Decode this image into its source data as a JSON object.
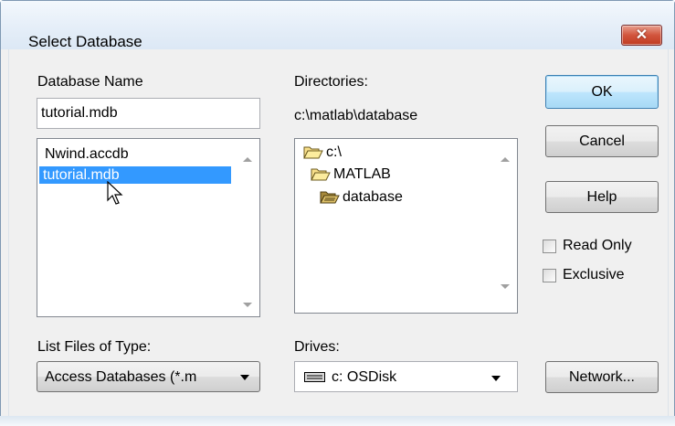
{
  "dialog": {
    "title": "Select Database",
    "close_glyph": "✕"
  },
  "database_name": {
    "label": "Database Name",
    "value": "tutorial.mdb",
    "files": [
      "Nwind.accdb",
      "tutorial.mdb"
    ],
    "selected_file": "tutorial.mdb"
  },
  "directories": {
    "label": "Directories:",
    "current_path": "c:\\matlab\\database",
    "tree": [
      {
        "name": "c:\\",
        "icon": "open-folder-icon"
      },
      {
        "name": "MATLAB",
        "icon": "open-folder-icon"
      },
      {
        "name": "database",
        "icon": "open-folder-icon"
      }
    ]
  },
  "buttons": {
    "ok": "OK",
    "cancel": "Cancel",
    "help": "Help",
    "network": "Network..."
  },
  "options": {
    "read_only": {
      "label": "Read Only",
      "checked": false
    },
    "exclusive": {
      "label": "Exclusive",
      "checked": false
    }
  },
  "file_type": {
    "label": "List Files of Type:",
    "selected": "Access Databases (*.m"
  },
  "drives": {
    "label": "Drives:",
    "selected": "c: OSDisk",
    "icon": "drive-icon"
  },
  "cursor": {
    "icon": "mouse-pointer-icon"
  },
  "colors": {
    "selection": "#3399ff",
    "title_bar": "#dce8f5",
    "close_button": "#c8472f",
    "default_button_border": "#3c7fb1"
  }
}
